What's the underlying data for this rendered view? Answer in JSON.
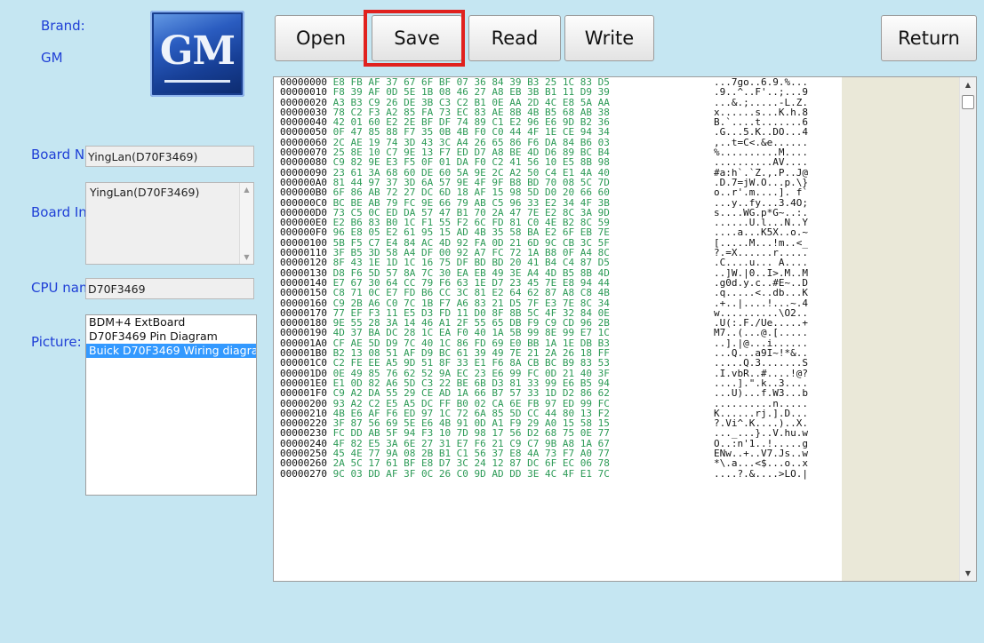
{
  "brand": {
    "label": "Brand:",
    "value": "GM",
    "logo_text": "GM"
  },
  "toolbar": {
    "open": "Open",
    "save": "Save",
    "read": "Read",
    "write": "Write",
    "return": "Return"
  },
  "board_name": {
    "label": "Board N",
    "value": "YingLan(D70F3469)"
  },
  "board_info": {
    "label": "Board In",
    "value": "YingLan(D70F3469)"
  },
  "cpu_name": {
    "label": "CPU nam",
    "value": "D70F3469"
  },
  "picture": {
    "label": "Picture:",
    "items": [
      {
        "text": "BDM+4 ExtBoard",
        "selected": false
      },
      {
        "text": "D70F3469 Pin Diagram",
        "selected": false
      },
      {
        "text": "Buick D70F3469 Wiring diagran",
        "selected": true
      }
    ]
  },
  "hex": {
    "rows": [
      {
        "addr": "00000000",
        "bytes": "E8 FB AF 37 67 6F BF 07 36 84 39 B3 25 1C 83 D5",
        "ascii": "...7go..6.9.%..."
      },
      {
        "addr": "00000010",
        "bytes": "F8 39 AF 0D 5E 1B 08 46 27 A8 EB 3B B1 11 D9 39",
        "ascii": ".9..^..F'..;...9"
      },
      {
        "addr": "00000020",
        "bytes": "A3 B3 C9 26 DE 3B C3 C2 B1 0E AA 2D 4C E8 5A AA",
        "ascii": "...&.;.....-L.Z."
      },
      {
        "addr": "00000030",
        "bytes": "78 C2 F3 A2 85 FA 73 EC 83 AE 8B 4B B5 68 AB 38",
        "ascii": "x......s...K.h.8"
      },
      {
        "addr": "00000040",
        "bytes": "42 01 60 E2 2E BF DF 74 89 C1 E2 96 E6 9D B2 36",
        "ascii": "B.`....t.......6"
      },
      {
        "addr": "00000050",
        "bytes": "0F 47 85 88 F7 35 0B 4B F0 C0 44 4F 1E CE 94 34",
        "ascii": ".G...5.K..DO...4"
      },
      {
        "addr": "00000060",
        "bytes": "2C AE 19 74 3D 43 3C A4 26 65 86 F6 DA 84 B6 03",
        "ascii": ",..t=C<.&e......"
      },
      {
        "addr": "00000070",
        "bytes": "25 8E 10 C7 9E 13 F7 ED D7 A8 BE 4D D6 89 BC B4",
        "ascii": "%..........M...."
      },
      {
        "addr": "00000080",
        "bytes": "C9 82 9E E3 F5 0F 01 DA F0 C2 41 56 10 E5 8B 98",
        "ascii": "..........AV...."
      },
      {
        "addr": "00000090",
        "bytes": "23 61 3A 68 60 DE 60 5A 9E 2C A2 50 C4 E1 4A 40",
        "ascii": "#a:h`.`Z.,.P..J@"
      },
      {
        "addr": "000000A0",
        "bytes": "81 44 97 37 3D 6A 57 9E 4F 9F B8 BD 70 08 5C 7D",
        "ascii": ".D.7=jW.O...p.\\}"
      },
      {
        "addr": "000000B0",
        "bytes": "6F 86 AB 72 27 DC 6D 18 AF 15 98 5D D0 20 66 60",
        "ascii": "o..r'.m....]. f`"
      },
      {
        "addr": "000000C0",
        "bytes": "BC BE AB 79 FC 9E 66 79 AB C5 96 33 E2 34 4F 3B",
        "ascii": "...y..fy...3.4O;"
      },
      {
        "addr": "000000D0",
        "bytes": "73 C5 0C ED DA 57 47 B1 70 2A 47 7E E2 8C 3A 9D",
        "ascii": "s....WG.p*G~..:."
      },
      {
        "addr": "000000E0",
        "bytes": "E2 B6 83 B0 1C F1 55 F2 6C FD 81 C0 4E B2 8C 59",
        "ascii": "......U.l...N..Y"
      },
      {
        "addr": "000000F0",
        "bytes": "96 E8 05 E2 61 95 15 AD 4B 35 58 BA E2 6F EB 7E",
        "ascii": "....a...K5X..o.~"
      },
      {
        "addr": "00000100",
        "bytes": "5B F5 C7 E4 84 AC 4D 92 FA 0D 21 6D 9C CB 3C 5F",
        "ascii": "[.....M...!m..<_"
      },
      {
        "addr": "00000110",
        "bytes": "3F B5 3D 58 A4 DF 00 92 A7 FC 72 1A B8 0F A4 8C",
        "ascii": "?.=X......r....."
      },
      {
        "addr": "00000120",
        "bytes": "8F 43 1E 1D 1C 16 75 DF BD BD 20 41 B4 C4 87 D5",
        "ascii": ".C....u... A...."
      },
      {
        "addr": "00000130",
        "bytes": "D8 F6 5D 57 8A 7C 30 EA EB 49 3E A4 4D B5 8B 4D",
        "ascii": "..]W.|0..I>.M..M"
      },
      {
        "addr": "00000140",
        "bytes": "E7 67 30 64 CC 79 F6 63 1E D7 23 45 7E E8 94 44",
        "ascii": ".g0d.y.c..#E~..D"
      },
      {
        "addr": "00000150",
        "bytes": "C8 71 0C E7 FD B6 CC 3C 81 E2 64 62 87 A8 C8 4B",
        "ascii": ".q.....<..db...K"
      },
      {
        "addr": "00000160",
        "bytes": "C9 2B A6 C0 7C 1B F7 A6 83 21 D5 7F E3 7E 8C 34",
        "ascii": ".+..|....!...~.4"
      },
      {
        "addr": "00000170",
        "bytes": "77 EF F3 11 E5 D3 FD 11 D0 8F 8B 5C 4F 32 84 0E",
        "ascii": "w..........\\O2.."
      },
      {
        "addr": "00000180",
        "bytes": "9E 55 28 3A 14 46 A1 2F 55 65 DB F9 C9 CD 96 2B",
        "ascii": ".U(:.F./Ue.....+"
      },
      {
        "addr": "00000190",
        "bytes": "4D 37 BA DC 28 1C EA F0 40 1A 5B 99 8E 99 E7 1C",
        "ascii": "M7..(...@.[....."
      },
      {
        "addr": "000001A0",
        "bytes": "CF AE 5D D9 7C 40 1C 86 FD 69 E0 BB 1A 1E DB B3",
        "ascii": "..].|@...i......"
      },
      {
        "addr": "000001B0",
        "bytes": "B2 13 08 51 AF D9 BC 61 39 49 7E 21 2A 26 18 FF",
        "ascii": "...Q...a9I~!*&.."
      },
      {
        "addr": "000001C0",
        "bytes": "C2 FE EE A5 9D 51 8F 33 E1 F6 8A CB BC B9 83 53",
        "ascii": ".....Q.3.......S"
      },
      {
        "addr": "000001D0",
        "bytes": "0E 49 85 76 62 52 9A EC 23 E6 99 FC 0D 21 40 3F",
        "ascii": ".I.vbR..#....!@?"
      },
      {
        "addr": "000001E0",
        "bytes": "E1 0D 82 A6 5D C3 22 BE 6B D3 81 33 99 E6 B5 94",
        "ascii": "....].\".k..3...."
      },
      {
        "addr": "000001F0",
        "bytes": "C9 A2 DA 55 29 CE AD 1A 66 B7 57 33 1D D2 86 62",
        "ascii": "...U)...f.W3...b"
      },
      {
        "addr": "00000200",
        "bytes": "93 A2 C2 E5 A5 DC FF B0 02 CA 6E FB 97 ED 99 FC",
        "ascii": "..........n....."
      },
      {
        "addr": "00000210",
        "bytes": "4B E6 AF F6 ED 97 1C 72 6A 85 5D CC 44 80 13 F2",
        "ascii": "K......rj.].D..."
      },
      {
        "addr": "00000220",
        "bytes": "3F 87 56 69 5E E6 4B 91 0D A1 F9 29 A0 15 58 15",
        "ascii": "?.Vi^.K....)..X."
      },
      {
        "addr": "00000230",
        "bytes": "FC DD AB 5F 94 F3 10 7D 98 17 56 D2 68 75 0E 77",
        "ascii": "..._...}..V.hu.w"
      },
      {
        "addr": "00000240",
        "bytes": "4F 82 E5 3A 6E 27 31 E7 F6 21 C9 C7 9B A8 1A 67",
        "ascii": "O..:n'1..!.....g"
      },
      {
        "addr": "00000250",
        "bytes": "45 4E 77 9A 08 2B B1 C1 56 37 E8 4A 73 F7 A0 77",
        "ascii": "ENw..+..V7.Js..w"
      },
      {
        "addr": "00000260",
        "bytes": "2A 5C 17 61 BF E8 D7 3C 24 12 87 DC 6F EC 06 78",
        "ascii": "*\\.a...<$...o..x"
      },
      {
        "addr": "00000270",
        "bytes": "9C 03 DD AF 3F 0C 26 C0 9D AD DD 3E 4C 4F E1 7C",
        "ascii": "....?.&....>LO.|"
      }
    ]
  },
  "colors": {
    "background": "#c5e6f2",
    "label": "#1f3fd6",
    "hex_bytes": "#2c9a56",
    "highlight": "#e0221f",
    "selection": "#3399ff"
  }
}
